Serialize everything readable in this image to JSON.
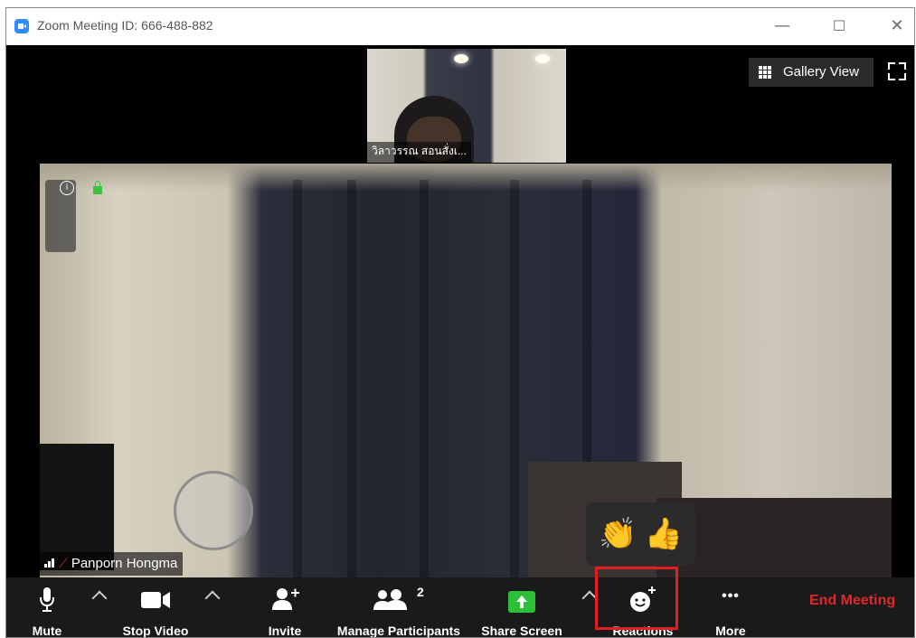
{
  "window": {
    "title": "Zoom Meeting ID: 666-488-882",
    "minimize": "—",
    "maximize": "☐",
    "close": "✕"
  },
  "thumbnail": {
    "name": "วิลาวรรณ สอนสั่งเ..."
  },
  "view": {
    "gallery_label": "Gallery View"
  },
  "main_video": {
    "name": "Panporn Hongma",
    "info_icon": "info-icon",
    "lock_icon": "lock-icon",
    "lock_color": "#3cc23c"
  },
  "reactions_popup": {
    "items": [
      "👏",
      "👍"
    ]
  },
  "toolbar": {
    "mute": "Mute",
    "stop_video": "Stop Video",
    "invite": "Invite",
    "manage_participants": "Manage Participants",
    "participant_count": "2",
    "share_screen": "Share Screen",
    "reactions": "Reactions",
    "more": "More",
    "more_glyph": "•••",
    "end_meeting": "End Meeting"
  },
  "colors": {
    "toolbar_bg": "#1a1a1a",
    "share_green": "#2dbf39",
    "end_red": "#e02828",
    "highlight_red": "#e41e1e",
    "zoom_blue": "#2d8cff"
  }
}
